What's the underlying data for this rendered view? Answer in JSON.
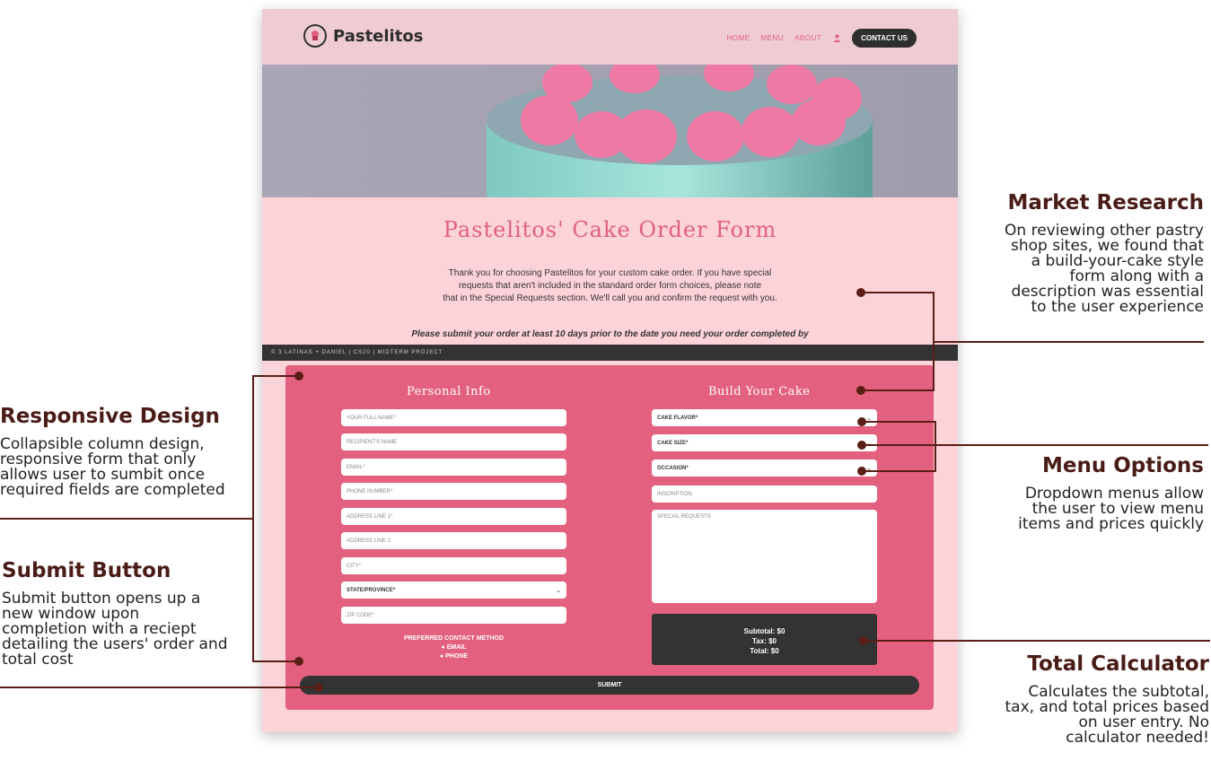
{
  "site": {
    "brand": "Pastelitos",
    "nav": [
      "HOME",
      "MENU",
      "ABOUT"
    ],
    "nav_cta": "CONTACT US",
    "page_title": "Pastelitos' Cake Order Form",
    "intro_lines": [
      "Thank you for choosing Pastelitos for your custom cake order. If you have special",
      "requests that aren't included in the standard order form choices, please note",
      "that in the Special Requests section. We'll call you and confirm the request with you."
    ],
    "notice": "Please submit your order at least 10 days prior to the date you need your order completed by",
    "footer_bar": "© 3 LATINAS + DANIEL | CS20 | MIDTERM PROJECT",
    "personal_title": "Personal Info",
    "cake_title": "Build Your Cake",
    "personal_fields": [
      "YOUR FULL NAME*",
      "RECIPIENT'S NAME",
      "EMAIL*",
      "PHONE NUMBER*",
      "ADDRESS LINE 1*",
      "ADDRESS LINE 2",
      "CITY*",
      "STATE/PROVINCE*",
      "ZIP CODE*"
    ],
    "cake_selects": [
      "CAKE FLAVOR*",
      "CAKE SIZE*",
      "OCCASION*"
    ],
    "inscription": "INSCRIPTION",
    "special_requests": "SPECIAL REQUESTS",
    "contact_label": "PREFERRED CONTACT METHOD",
    "contact_options": [
      "EMAIL",
      "PHONE"
    ],
    "subtotal": "Subtotal: $0",
    "tax": "Tax: $0",
    "total": "Total: $0",
    "submit": "SUBMIT"
  },
  "annotations": {
    "market_research": {
      "title": "Market Research",
      "lines": [
        "On reviewing other pastry",
        "shop sites, we found that",
        "a build-your-cake style",
        "form along with a",
        "description was essential",
        "to the user experience"
      ]
    },
    "responsive_design": {
      "title": "Responsive Design",
      "lines": [
        "Collapsible column design,",
        "responsive form that only",
        "allows user to sumbit once",
        "required fields are completed"
      ]
    },
    "menu_options": {
      "title": "Menu Options",
      "lines": [
        "Dropdown menus allow",
        "the user to view menu",
        "items and prices quickly"
      ]
    },
    "submit_button": {
      "title": "Submit Button",
      "lines": [
        "Submit button opens up a",
        "new window upon",
        "completion with a reciept",
        "detailing the users' order and",
        "total cost"
      ]
    },
    "total_calculator": {
      "title": "Total Calculator",
      "lines": [
        "Calculates the subtotal,",
        "tax, and total prices based",
        "on user entry. No",
        "calculator needed!"
      ]
    }
  },
  "colors": {
    "accent": "#e05f7f",
    "form_bg": "#e3607e",
    "page_bg": "#fdd3da",
    "annotation_line": "#5a1e16"
  }
}
